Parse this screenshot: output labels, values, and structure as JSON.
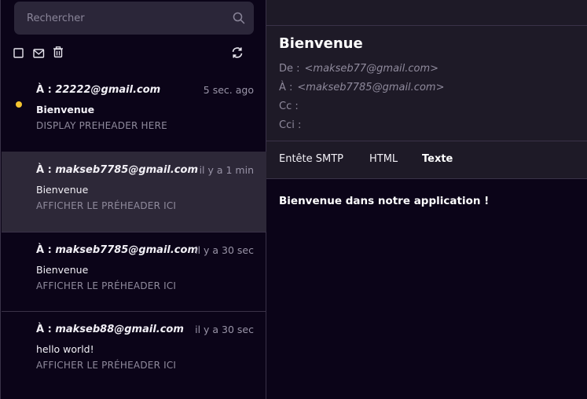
{
  "search": {
    "placeholder": "Rechercher",
    "icon": "search-icon"
  },
  "toolbar": {
    "select_all_icon": "checkbox-icon",
    "mark_read_icon": "envelope-icon",
    "delete_icon": "trash-icon",
    "refresh_icon": "refresh-icon"
  },
  "messages": [
    {
      "to_label": "À :",
      "to": "22222@gmail.com",
      "time": "5 sec. ago",
      "subject": "Bienvenue",
      "preheader": "DISPLAY PREHEADER HERE",
      "unread": true
    },
    {
      "to_label": "À :",
      "to": "makseb7785@gmail.com",
      "time": "il y a 1 min",
      "subject": "Bienvenue",
      "preheader": "AFFICHER LE PRÉHEADER ICI",
      "unread": false,
      "selected": true
    },
    {
      "to_label": "À :",
      "to": "makseb7785@gmail.com",
      "time": "il y a 30 sec",
      "subject": "Bienvenue",
      "preheader": "AFFICHER LE PRÉHEADER ICI",
      "unread": false
    },
    {
      "to_label": "À :",
      "to": "makseb88@gmail.com",
      "time": "il y a 30 sec",
      "subject": "hello world!",
      "preheader": "AFFICHER LE PRÉHEADER ICI",
      "unread": false
    }
  ],
  "detail": {
    "title": "Bienvenue",
    "from_label": "De :",
    "from": "<makseb77@gmail.com>",
    "to_label": "À :",
    "to": "<makseb7785@gmail.com>",
    "cc_label": "Cc :",
    "bcc_label": "Cci :",
    "tabs": [
      "Entête SMTP",
      "HTML",
      "Texte"
    ],
    "active_tab": "Texte",
    "body": "Bienvenue dans notre application !"
  },
  "colors": {
    "accent_dot": "#f4c430",
    "background": "#0b0418",
    "panel": "#1e1a27",
    "selected_row": "#2d2838"
  }
}
